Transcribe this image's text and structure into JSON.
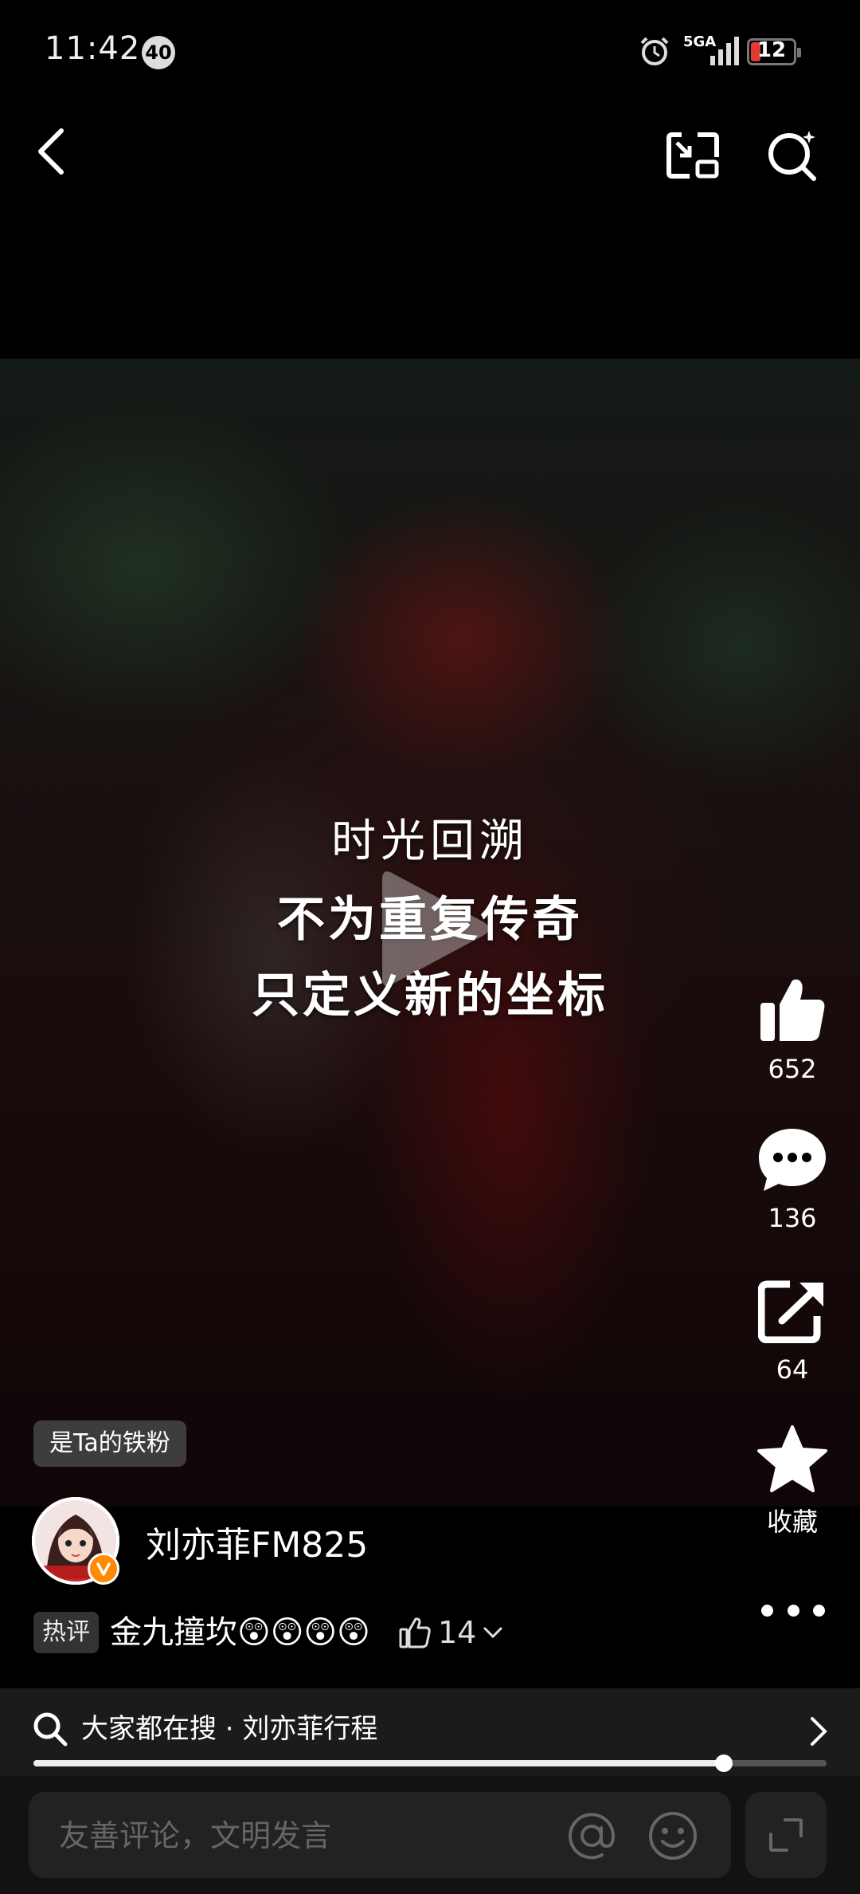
{
  "status_bar": {
    "time": "11:42",
    "notification_badge": "40",
    "network": "5GA",
    "battery_level": "12",
    "icons": [
      "alarm-icon",
      "signal-icon",
      "battery-icon"
    ]
  },
  "top_nav": {
    "icons": [
      "back-icon",
      "pip-icon",
      "search-icon"
    ]
  },
  "video": {
    "caption_lines": [
      "时光回溯",
      "不为重复传奇",
      "只定义新的坐标"
    ],
    "progress": 0.87
  },
  "actions": {
    "like_count": "652",
    "comment_count": "136",
    "share_count": "64",
    "favorite_label": "收藏"
  },
  "author": {
    "fan_tag": "是Ta的铁粉",
    "name": "刘亦菲FM825",
    "verified": true
  },
  "hot_comment": {
    "tag": "热评",
    "text": "金九撞坎😲😲😲😲",
    "like_count": "14"
  },
  "search_suggestion": {
    "text": "大家都在搜 · 刘亦菲行程"
  },
  "comment_bar": {
    "placeholder": "友善评论，文明发言"
  },
  "colors": {
    "background": "#000000",
    "verified_badge": "#ff8a00",
    "battery_low": "#e53935"
  }
}
